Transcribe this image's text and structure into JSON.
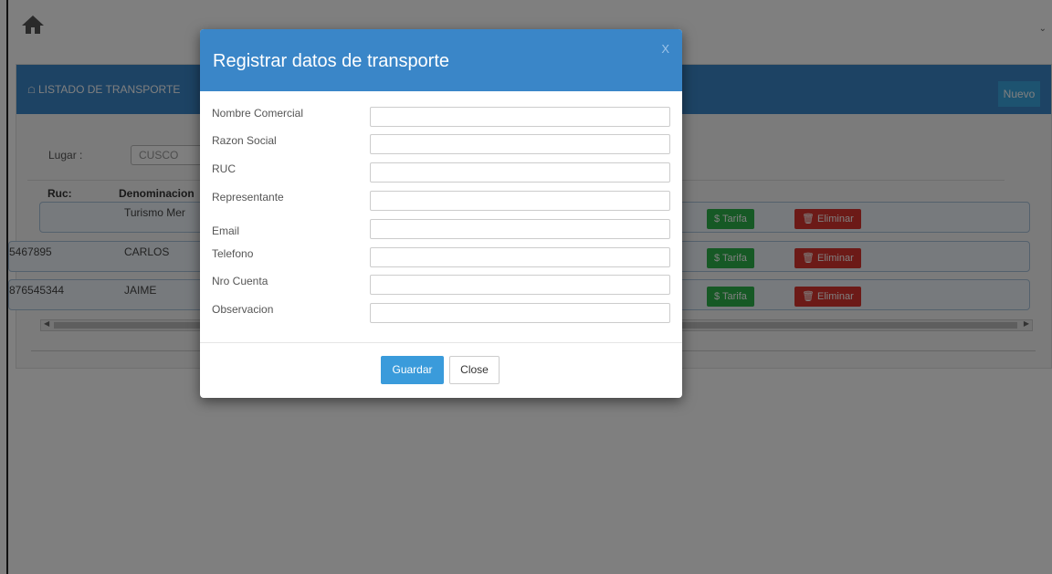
{
  "topbar": {
    "home_icon": "home-icon",
    "chevron_icon": "chevron-down-icon"
  },
  "panel": {
    "title": "LISTADO DE TRANSPORTE",
    "title_icon": "home-icon",
    "nuevo_label": "Nuevo",
    "lugar_label": "Lugar :",
    "lugar_value": "CUSCO",
    "columns": {
      "ruc": "Ruc:",
      "denominacion": "Denominacion"
    },
    "rows": [
      {
        "ruc": "",
        "denominacion": "Turismo Mer",
        "tarifa_label": "$ Tarifa",
        "eliminar_label": "🗑 Eliminar"
      },
      {
        "ruc": "5467895",
        "denominacion": "CARLOS",
        "tarifa_label": "$ Tarifa",
        "eliminar_label": "🗑 Eliminar"
      },
      {
        "ruc": "876545344",
        "denominacion": "JAIME",
        "tarifa_label": "$ Tarifa",
        "eliminar_label": "🗑 Eliminar"
      }
    ]
  },
  "modal": {
    "title": "Registrar datos de transporte",
    "close_x": "X",
    "fields": [
      {
        "label": "Nombre Comercial",
        "value": ""
      },
      {
        "label": "Razon Social",
        "value": ""
      },
      {
        "label": "RUC",
        "value": ""
      },
      {
        "label": "Representante",
        "value": ""
      },
      {
        "label": "Email",
        "value": ""
      },
      {
        "label": "Telefono",
        "value": ""
      },
      {
        "label": "Nro Cuenta",
        "value": ""
      },
      {
        "label": "Observacion",
        "value": ""
      }
    ],
    "guardar_label": "Guardar",
    "close_label": "Close"
  },
  "colors": {
    "primary": "#3a86c8",
    "success": "#2db34a",
    "danger": "#d9352e",
    "button_blue": "#3a9bdb"
  }
}
